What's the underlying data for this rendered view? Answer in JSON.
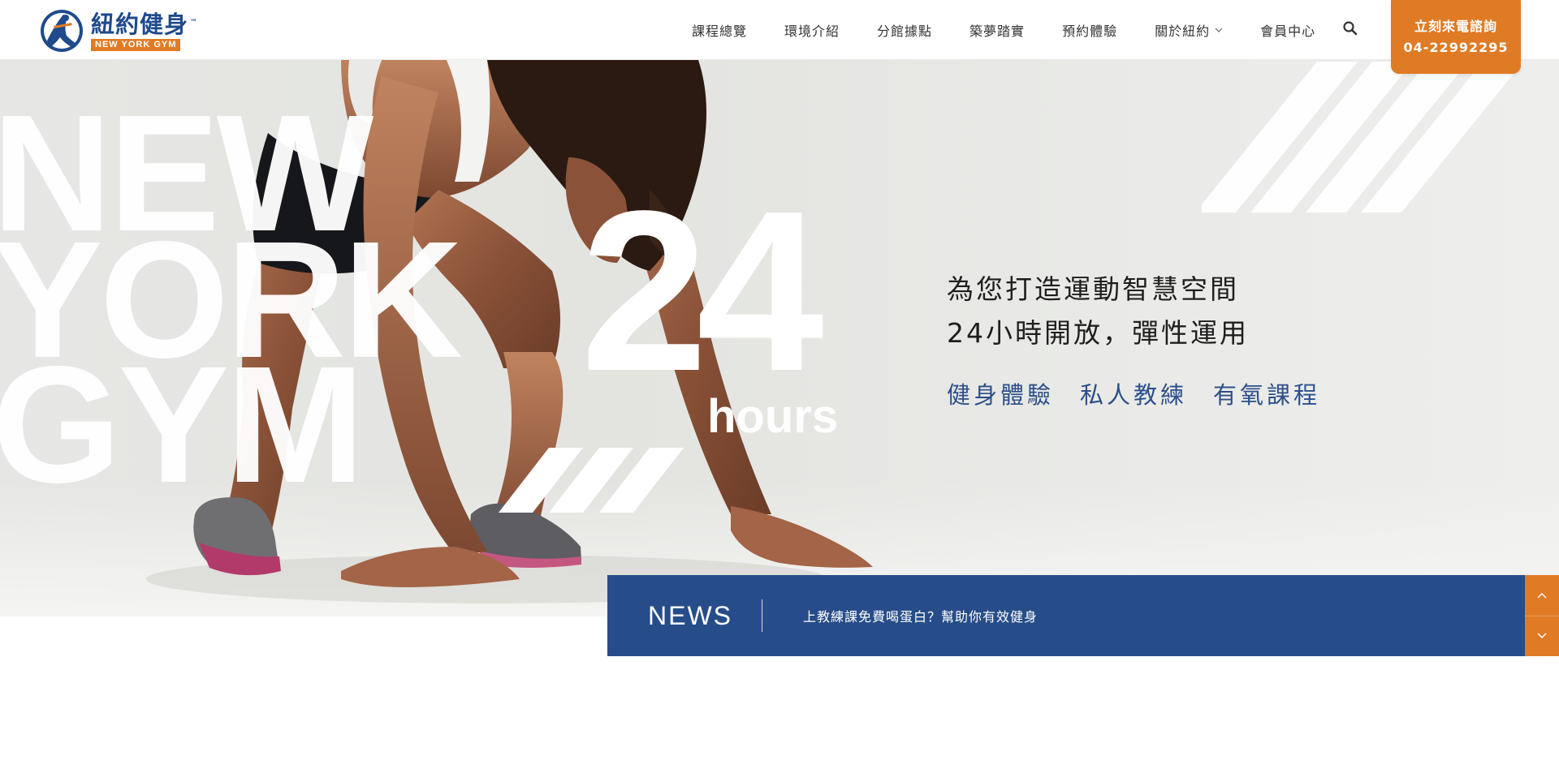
{
  "colors": {
    "brand_blue": "#264d89",
    "accent_orange": "#e07b25",
    "tagline_blue": "#2c4f8a"
  },
  "logo": {
    "name_cn": "紐約健身",
    "tm": "™",
    "name_en": "NEW YORK GYM"
  },
  "nav": {
    "items": [
      {
        "label": "課程總覽"
      },
      {
        "label": "環境介紹"
      },
      {
        "label": "分館據點"
      },
      {
        "label": "築夢踏實"
      },
      {
        "label": "預約體驗"
      },
      {
        "label": "關於紐約",
        "has_dropdown": true
      },
      {
        "label": "會員中心"
      }
    ],
    "search_icon": "search-icon"
  },
  "cta": {
    "line1": "立刻來電諮詢",
    "phone": "04-22992295"
  },
  "hero": {
    "big_words": [
      "NEW",
      "YORK",
      "GYM"
    ],
    "big_number": "24",
    "hours": "hours",
    "tagline_line1": "為您打造運動智慧空間",
    "tagline_line2": "24小時開放，彈性運用",
    "services": [
      "健身體驗",
      "私人教練",
      "有氧課程"
    ]
  },
  "news": {
    "label": "NEWS",
    "headline": "上教練課免費喝蛋白？幫助你有效健身",
    "prev_icon": "chevron-up-icon",
    "next_icon": "chevron-down-icon"
  }
}
